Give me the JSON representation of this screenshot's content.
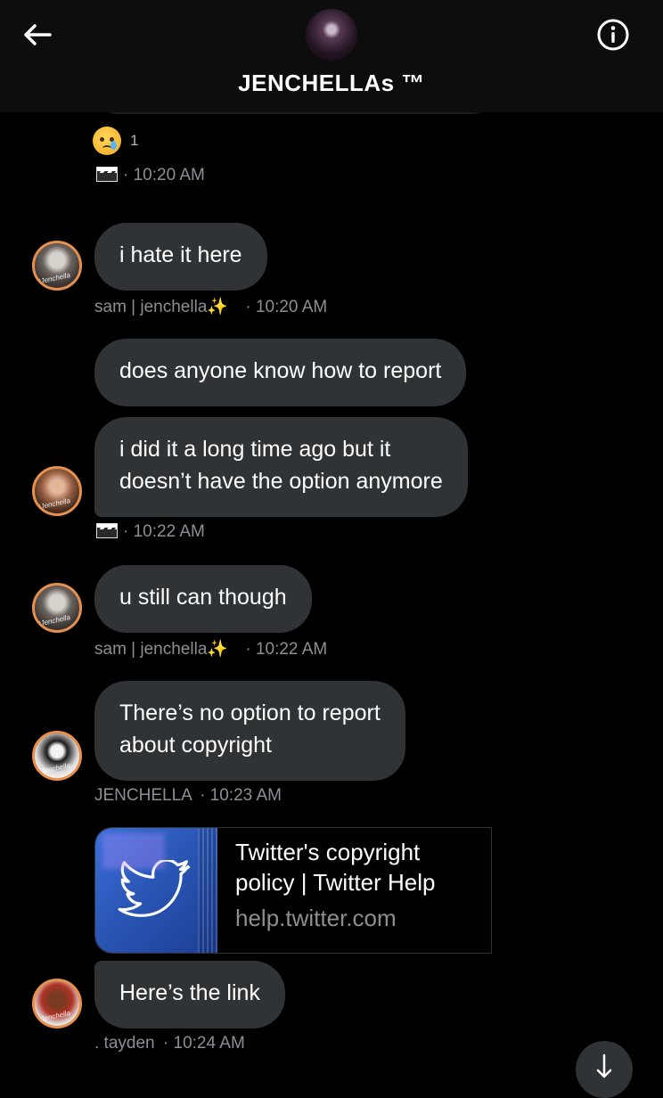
{
  "header": {
    "title": "JENCHELLAs ™"
  },
  "reaction": {
    "emoji": "😢",
    "count": "1"
  },
  "messages": [
    {
      "meta": "· 10:20 AM"
    },
    {
      "text": "i hate it here",
      "sender": "sam | jenchella",
      "sender_emoji": "✨",
      "time": "· 10:20 AM"
    },
    {
      "text": "does anyone know how to report"
    },
    {
      "line1": "i did it a long time ago but it",
      "line2": "doesn’t have the option anymore",
      "time": "· 10:22 AM"
    },
    {
      "text": "u still can though",
      "sender": "sam | jenchella",
      "sender_emoji": "✨",
      "time": "· 10:22 AM"
    },
    {
      "line1": "There’s no option to report",
      "line2": "about copyright",
      "sender": "JENCHELLA",
      "time": "· 10:23 AM"
    },
    {
      "text": "Here’s the link",
      "sender": ". tayden",
      "time": "· 10:24 AM"
    }
  ],
  "link_card": {
    "title": "Twitter's copyright policy | Twitter Help",
    "domain": "help.twitter.com"
  },
  "colors": {
    "bubble": "#2f3336",
    "avatar_ring": "#e7904d",
    "link_thumb": "#2b56b6"
  }
}
